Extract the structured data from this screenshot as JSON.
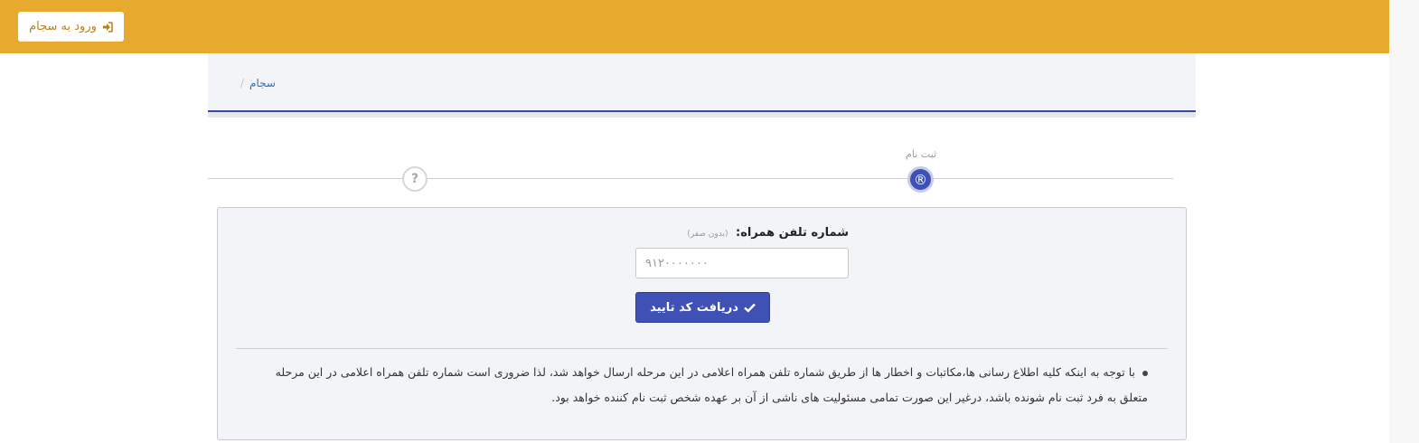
{
  "header": {
    "login_label": "ورود به سجام",
    "login_icon": "sign-in-icon",
    "bar_color": "#e8aa2e"
  },
  "breadcrumb": {
    "items": [
      "سجام"
    ],
    "separator": "/"
  },
  "steps": {
    "active_label": "ثبت نام",
    "active_symbol": "®",
    "next_symbol": "?",
    "accent_color": "#3f51b5"
  },
  "form": {
    "phone_label": "شماره تلفن همراه:",
    "phone_hint": "(بدون صفر)",
    "phone_placeholder": "۹۱۲۰۰۰۰۰۰۰",
    "phone_value": "",
    "submit_label": "دریافت کد تایید",
    "submit_icon": "check-icon"
  },
  "notice": {
    "text": "با توجه به اینکه کلیه اطلاع رسانی ها،مکاتبات و اخطار ها از طریق شماره تلفن همراه اعلامی در این مرحله ارسال خواهد شد، لذا ضروری است شماره تلفن همراه اعلامی در این مرحله متعلق به فرد ثبت نام شونده باشد، درغیر این صورت تمامی مسئولیت های ناشی از آن بر عهده شخص ثبت نام کننده خواهد بود."
  }
}
